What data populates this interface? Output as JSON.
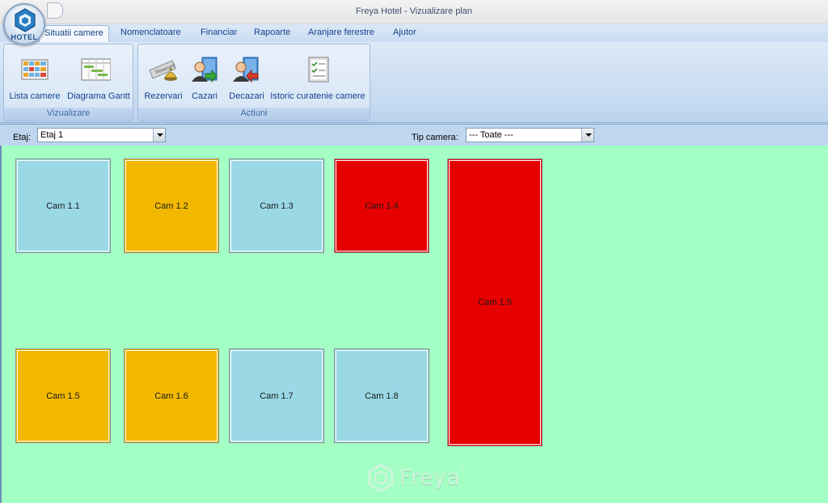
{
  "app": {
    "title": "Freya Hotel - Vizualizare plan",
    "orb_text": "HOTEL"
  },
  "menu": {
    "tabs": [
      {
        "label": "Situatii camere",
        "active": true
      },
      {
        "label": "Nomenclatoare"
      },
      {
        "label": "Financiar"
      },
      {
        "label": "Rapoarte"
      },
      {
        "label": "Aranjare ferestre"
      },
      {
        "label": "Ajutor"
      }
    ]
  },
  "ribbon": {
    "groups": [
      {
        "label": "Vizualizare",
        "buttons": [
          {
            "label": "Lista camere",
            "icon": "room-list-icon"
          },
          {
            "label": "Diagrama Gantt",
            "icon": "gantt-chart-icon"
          }
        ]
      },
      {
        "label": "Actiuni",
        "buttons": [
          {
            "label": "Rezervari",
            "icon": "reservation-bell-icon"
          },
          {
            "label": "Cazari",
            "icon": "checkin-user-icon"
          },
          {
            "label": "Decazari",
            "icon": "checkout-user-icon"
          },
          {
            "label": "Istoric curatenie camere",
            "icon": "cleaning-history-icon"
          }
        ]
      }
    ]
  },
  "filters": {
    "floor_label": "Etaj:",
    "floor_value": "Etaj 1",
    "room_type_label": "Tip camera:",
    "room_type_value": "--- Toate ---"
  },
  "rooms": [
    {
      "label": "Cam 1.1",
      "status": "free"
    },
    {
      "label": "Cam 1.2",
      "status": "reserved"
    },
    {
      "label": "Cam 1.3",
      "status": "free"
    },
    {
      "label": "Cam 1.4",
      "status": "occupied"
    },
    {
      "label": "Cam 1.5",
      "status": "reserved"
    },
    {
      "label": "Cam 1.6",
      "status": "reserved"
    },
    {
      "label": "Cam 1.7",
      "status": "free"
    },
    {
      "label": "Cam 1.8",
      "status": "free"
    },
    {
      "label": "Cam 1.9",
      "status": "occupied"
    }
  ],
  "colors": {
    "plan_background": "#a3ffc4",
    "free": "#9ad8e6",
    "reserved": "#f2b800",
    "occupied": "#e60000"
  },
  "brand": {
    "name": "Freya",
    "mark": "®"
  }
}
